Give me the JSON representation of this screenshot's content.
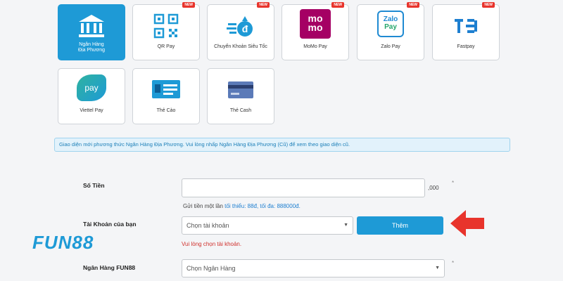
{
  "payment_methods": [
    {
      "label_1": "Ngân Hàng",
      "label_2": "Địa Phương",
      "badge": "",
      "icon": "bank-icon"
    },
    {
      "label_1": "QR Pay",
      "label_2": "",
      "badge": "NEW",
      "icon": "qr-code-icon"
    },
    {
      "label_1": "Chuyển Khoản Siêu Tốc",
      "label_2": "",
      "badge": "NEW",
      "icon": "fast-transfer-icon"
    },
    {
      "label_1": "MoMo Pay",
      "label_2": "",
      "badge": "NEW",
      "icon": "momo-icon",
      "logo_text_1": "mo",
      "logo_text_2": "mo"
    },
    {
      "label_1": "Zalo Pay",
      "label_2": "",
      "badge": "NEW",
      "icon": "zalo-pay-icon",
      "logo_text_1": "Zalo",
      "logo_text_2": "Pay"
    },
    {
      "label_1": "Fastpay",
      "label_2": "",
      "badge": "NEW",
      "icon": "fastpay-icon"
    },
    {
      "label_1": "Viettel Pay",
      "label_2": "",
      "badge": "",
      "icon": "viettel-pay-icon",
      "logo_text_1": "pay"
    },
    {
      "label_1": "Thẻ Cào",
      "label_2": "",
      "badge": "",
      "icon": "scratch-card-icon"
    },
    {
      "label_1": "Thẻ Cash",
      "label_2": "",
      "badge": "",
      "icon": "cash-card-icon"
    }
  ],
  "notice": "Giao diện mới phương thức Ngân Hàng Địa Phương. Vui lòng nhấp Ngân Hàng Địa Phương (Cũ) để xem theo giao diện cũ.",
  "form": {
    "amount_label": "Số Tiền",
    "amount_value": "",
    "amount_suffix": ",000",
    "required_mark": "*",
    "limit_prefix": "Gửi tiền một lần",
    "limit_highlight": "tối thiểu:  88đ, tối đa: 888000đ.",
    "account_label": "Tài Khoản của bạn",
    "account_select": "Chọn tài khoản",
    "add_button": "Thêm",
    "account_error": "Vui lòng chọn tài khoản.",
    "bank_label": "Ngân Hàng FUN88",
    "bank_select": "Chọn Ngân Hàng"
  },
  "brand": {
    "logo": "FUN88",
    "accent": "#1e9ad6",
    "arrow_color": "#e8342c"
  }
}
